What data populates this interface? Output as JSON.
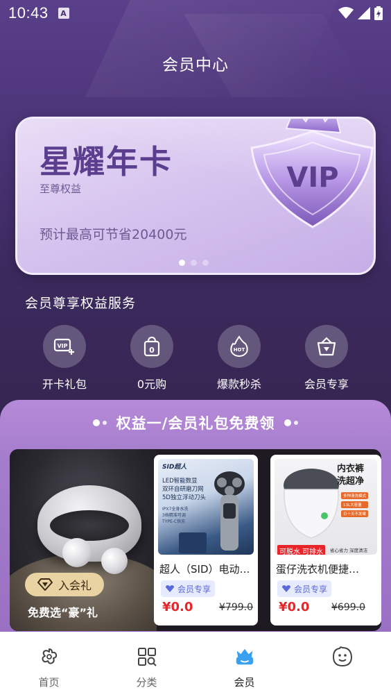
{
  "status_bar": {
    "time": "10:43",
    "notification_letter": "A"
  },
  "header": {
    "title": "会员中心"
  },
  "card": {
    "title": "星耀年卡",
    "subtitle": "至尊权益",
    "saving_text": "预计最高可节省20400元",
    "vip_text": "VIP",
    "carousel_pages": 3,
    "active_page": 1
  },
  "benefits": {
    "title": "会员尊享权益服务",
    "items": [
      {
        "label": "开卡礼包",
        "icon": "vip-card-icon"
      },
      {
        "label": "0元购",
        "icon": "zero-bag-icon"
      },
      {
        "label": "爆款秒杀",
        "icon": "hot-fire-icon"
      },
      {
        "label": "会员专享",
        "icon": "diamond-basket-icon"
      }
    ]
  },
  "gift_section": {
    "title": "权益一/会员礼包免费领",
    "promo": {
      "badge": "入会礼",
      "caption": "免费选“豪”礼"
    },
    "products": [
      {
        "name": "超人（SID）电动…",
        "tag": "会员专享",
        "price": "¥0.0",
        "original_price": "¥799.0",
        "image": {
          "brand": "SID超人",
          "line1": "LED智能数显",
          "line2": "双环自研磨刀网",
          "line3": "5D独立浮动刀头",
          "bullets": [
            "IPX7全身水洗",
            "3档精准可调",
            "TYPE-C快充"
          ]
        }
      },
      {
        "name": "蛋仔洗衣机便捷…",
        "tag": "会员专享",
        "price": "¥0.0",
        "original_price": "¥699.0",
        "image": {
          "line1": "内衣裤",
          "line2": "洗超净",
          "chips": [
            "多种清洗模式",
            "13L大容量",
            "日十天不发霉"
          ],
          "feature1": "可脱水 可排水",
          "feature2": "省心省力 深度清洁"
        }
      }
    ]
  },
  "bottom_nav": {
    "items": [
      {
        "label": "首页",
        "icon": "home-flower-icon",
        "active": false
      },
      {
        "label": "分类",
        "icon": "category-grid-icon",
        "active": false
      },
      {
        "label": "会员",
        "icon": "member-crown-icon",
        "active": true
      },
      {
        "label": "",
        "icon": "mascot-face-icon",
        "active": false
      }
    ]
  },
  "colors": {
    "hero_top": "#5a3f8a",
    "hero_bottom": "#35254f",
    "card_title": "#5b3f8e",
    "gift_panel": "#a57ccd",
    "price_red": "#e8262a",
    "member_blue": "#3aa0f0"
  }
}
